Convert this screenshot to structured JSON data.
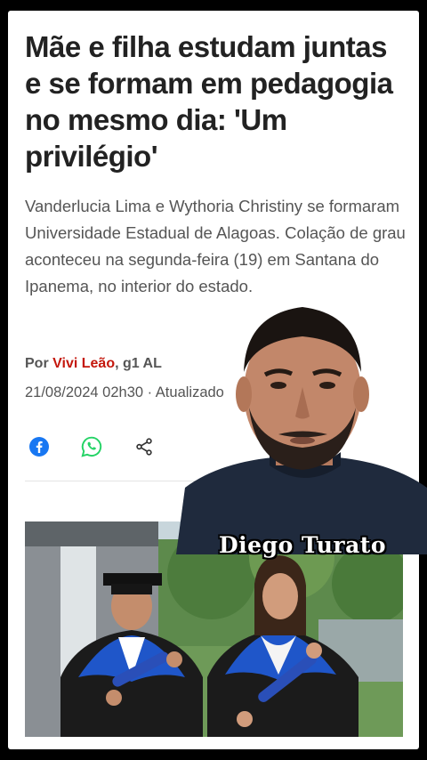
{
  "article": {
    "headline": "Mãe e filha estudam juntas e se formam em pedagogia no mesmo dia: 'Um privilégio'",
    "subtitle": "Vanderlucia Lima e Wythoria Christiny se formaram Universidade Estadual de Alagoas. Colação de grau aconteceu na segunda-feira (19) em Santana do Ipanema, no interior do estado.",
    "byline_prefix": "Por",
    "author": "Vivi Leão",
    "outlet": ", g1 AL",
    "dateline": "21/08/2024 02h30 · Atualizado"
  },
  "share": {
    "icons": [
      "facebook-icon",
      "whatsapp-icon",
      "share-icon"
    ]
  },
  "overlay": {
    "caption": "Diego Turato"
  },
  "colors": {
    "author_red": "#c4170c",
    "facebook_blue": "#1877f2",
    "whatsapp_green": "#25d366",
    "gown_blue": "#1f56c9"
  }
}
